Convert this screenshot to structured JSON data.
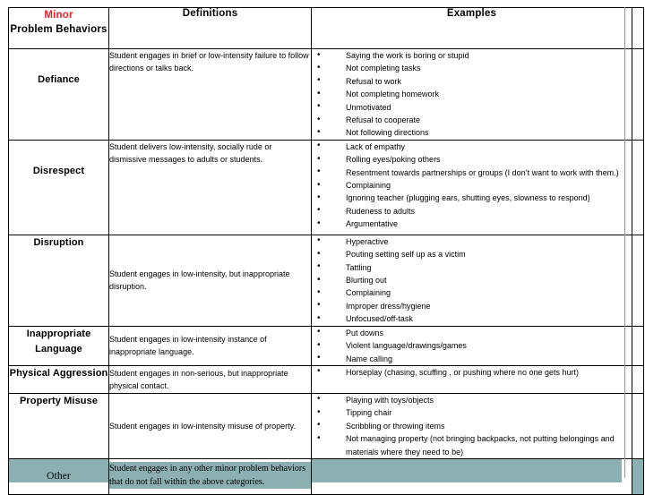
{
  "header": {
    "behavior_minor": "Minor",
    "behavior_main": "Problem Behaviors",
    "definitions": "Definitions",
    "examples": "Examples"
  },
  "colors": {
    "minor_red": "#EE1C25",
    "highlight_teal": "#8CAFB1",
    "border_black": "#000000",
    "tail_gray": "#9A9A9A"
  },
  "rows": [
    {
      "behavior": "Defiance",
      "definition": "Student engages in brief or low-intensity failure to follow directions or talks back.",
      "examples": [
        "Saying the work is boring or stupid",
        "Not completing tasks",
        "Refusal to work",
        "Not completing homework",
        "Unmotivated",
        "Refusal to cooperate",
        "Not following directions"
      ]
    },
    {
      "behavior": "Disrespect",
      "definition": "Student delivers low-intensity, socially rude or dismissive messages to adults or students.",
      "examples": [
        "Lack of empathy",
        "Rolling eyes/poking others",
        "Resentment towards partnerships or groups (I don’t want to work with them.)",
        "Complaining",
        "Ignoring teacher (plugging ears, shutting eyes, slowness to respond)",
        "Rudeness to adults",
        "Argumentative"
      ]
    },
    {
      "behavior": "Disruption",
      "definition": "Student engages in low-intensity, but inappropriate disruption.",
      "examples": [
        "Hyperactive",
        "Pouting setting self up as a victim",
        "Tattling",
        "Blurting out",
        "Complaining",
        "Improper dress/hygiene",
        "Unfocused/off-task"
      ]
    },
    {
      "behavior": "Inappropriate Language",
      "definition": "Student engages in low-intensity instance of inappropriate language.",
      "examples": [
        "Put downs",
        "Violent language/drawings/games",
        "Name calling"
      ]
    },
    {
      "behavior": "Physical Aggression",
      "definition": "Student engages in non-serious, but inappropriate physical contact.",
      "examples": [
        "Horseplay (chasing, scuffing , or pushing where no one gets hurt)"
      ]
    },
    {
      "behavior": "Property Misuse",
      "definition": "Student engages in low-intensity misuse of property.",
      "examples": [
        "Playing with toys/objects",
        "Tipping chair",
        "Scribbling or throwing items",
        "Not managing property (not bringing backpacks, not putting belongings and materials where they need to be)"
      ]
    },
    {
      "behavior": "Other",
      "definition": "Student engages in any other minor problem behaviors that do not fall within the above categories.",
      "examples": []
    }
  ]
}
